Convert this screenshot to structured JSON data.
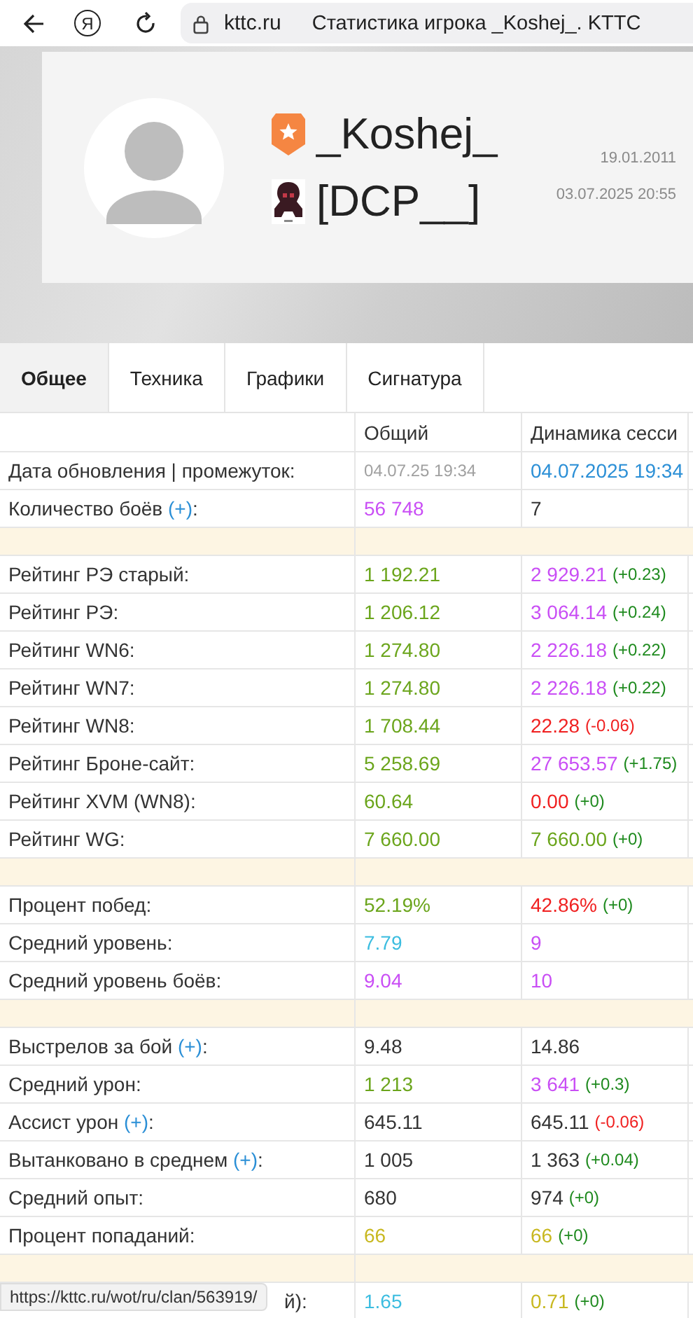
{
  "browser": {
    "logo_glyph": "Я",
    "url": "kttc.ru",
    "title": "Статистика игрока _Koshej_. KTTC"
  },
  "profile": {
    "name": "_Koshej_",
    "clan": "[DCP__]",
    "registered": "19.01.2011",
    "last_battle": "03.07.2025 20:55"
  },
  "tabs": [
    {
      "label": "Общее",
      "selected": true
    },
    {
      "label": "Техника",
      "selected": false
    },
    {
      "label": "Графики",
      "selected": false
    },
    {
      "label": "Сигнатура",
      "selected": false
    }
  ],
  "table": {
    "columns": [
      "Общий",
      "Динамика сесси"
    ],
    "rows": [
      {
        "kind": "row",
        "label": "Дата обновления | промежуток:",
        "total": {
          "text": "04.07.25 19:34",
          "color": "#a0a0a0",
          "small": true
        },
        "session": {
          "text": "04.07.2025 19:34",
          "color": "#2b8fd6"
        }
      },
      {
        "kind": "row",
        "label_parts": [
          {
            "text": "Количество боёв "
          },
          {
            "text": "(+)",
            "kind": "link"
          },
          {
            "text": ":"
          }
        ],
        "total": {
          "text": "56 748",
          "color": "#c94ef5"
        },
        "session": {
          "text": "7",
          "color": "#333333"
        }
      },
      {
        "kind": "separator"
      },
      {
        "kind": "row",
        "label": "Рейтинг РЭ старый:",
        "total": {
          "text": "1 192.21",
          "color": "#6ba51c"
        },
        "session": {
          "text": "2 929.21",
          "color": "#c94ef5"
        },
        "delta": {
          "text": "(+0.23)",
          "color": "#1e8a1e"
        }
      },
      {
        "kind": "row",
        "label": "Рейтинг РЭ:",
        "total": {
          "text": "1 206.12",
          "color": "#6ba51c"
        },
        "session": {
          "text": "3 064.14",
          "color": "#c94ef5"
        },
        "delta": {
          "text": "(+0.24)",
          "color": "#1e8a1e"
        }
      },
      {
        "kind": "row",
        "label": "Рейтинг WN6:",
        "total": {
          "text": "1 274.80",
          "color": "#6ba51c"
        },
        "session": {
          "text": "2 226.18",
          "color": "#c94ef5"
        },
        "delta": {
          "text": "(+0.22)",
          "color": "#1e8a1e"
        }
      },
      {
        "kind": "row",
        "label": "Рейтинг WN7:",
        "total": {
          "text": "1 274.80",
          "color": "#6ba51c"
        },
        "session": {
          "text": "2 226.18",
          "color": "#c94ef5"
        },
        "delta": {
          "text": "(+0.22)",
          "color": "#1e8a1e"
        }
      },
      {
        "kind": "row",
        "label": "Рейтинг WN8:",
        "total": {
          "text": "1 708.44",
          "color": "#6ba51c"
        },
        "session": {
          "text": "22.28",
          "color": "#f02020"
        },
        "delta": {
          "text": "(-0.06)",
          "color": "#f02020"
        }
      },
      {
        "kind": "row",
        "label": "Рейтинг Броне-сайт:",
        "total": {
          "text": "5 258.69",
          "color": "#6ba51c"
        },
        "session": {
          "text": "27 653.57",
          "color": "#c94ef5"
        },
        "delta": {
          "text": "(+1.75)",
          "color": "#1e8a1e"
        }
      },
      {
        "kind": "row",
        "label": "Рейтинг XVM (WN8):",
        "total": {
          "text": "60.64",
          "color": "#6ba51c"
        },
        "session": {
          "text": "0.00",
          "color": "#f02020"
        },
        "delta": {
          "text": "(+0)",
          "color": "#1e8a1e"
        }
      },
      {
        "kind": "row",
        "label": "Рейтинг WG:",
        "total": {
          "text": "7 660.00",
          "color": "#6ba51c"
        },
        "session": {
          "text": "7 660.00",
          "color": "#6ba51c"
        },
        "delta": {
          "text": "(+0)",
          "color": "#1e8a1e"
        }
      },
      {
        "kind": "separator"
      },
      {
        "kind": "row",
        "label": "Процент побед:",
        "total": {
          "text": "52.19%",
          "color": "#6ba51c"
        },
        "session": {
          "text": "42.86%",
          "color": "#f02020"
        },
        "delta": {
          "text": "(+0)",
          "color": "#1e8a1e"
        }
      },
      {
        "kind": "row",
        "label": "Средний уровень:",
        "total": {
          "text": "7.79",
          "color": "#3cbde0"
        },
        "session": {
          "text": "9",
          "color": "#c94ef5"
        }
      },
      {
        "kind": "row",
        "label": "Средний уровень боёв:",
        "total": {
          "text": "9.04",
          "color": "#c94ef5"
        },
        "session": {
          "text": "10",
          "color": "#c94ef5"
        }
      },
      {
        "kind": "separator"
      },
      {
        "kind": "row",
        "label_parts": [
          {
            "text": "Выстрелов за бой "
          },
          {
            "text": "(+)",
            "kind": "link"
          },
          {
            "text": ":"
          }
        ],
        "total": {
          "text": "9.48",
          "color": "#333333"
        },
        "session": {
          "text": "14.86",
          "color": "#333333"
        }
      },
      {
        "kind": "row",
        "label": "Средний урон:",
        "total": {
          "text": "1 213",
          "color": "#6ba51c"
        },
        "session": {
          "text": "3 641",
          "color": "#c94ef5"
        },
        "delta": {
          "text": "(+0.3)",
          "color": "#1e8a1e"
        }
      },
      {
        "kind": "row",
        "label_parts": [
          {
            "text": "Ассист урон "
          },
          {
            "text": "(+)",
            "kind": "link"
          },
          {
            "text": ":"
          }
        ],
        "total": {
          "text": "645.11",
          "color": "#333333"
        },
        "session": {
          "text": "645.11",
          "color": "#333333"
        },
        "delta": {
          "text": "(-0.06)",
          "color": "#f02020"
        }
      },
      {
        "kind": "row",
        "label_parts": [
          {
            "text": "Вытанковано в среднем "
          },
          {
            "text": "(+)",
            "kind": "link"
          },
          {
            "text": ":"
          }
        ],
        "total": {
          "text": "1 005",
          "color": "#333333"
        },
        "session": {
          "text": "1 363",
          "color": "#333333"
        },
        "delta": {
          "text": "(+0.04)",
          "color": "#1e8a1e"
        }
      },
      {
        "kind": "row",
        "label": "Средний опыт:",
        "total": {
          "text": "680",
          "color": "#333333"
        },
        "session": {
          "text": "974",
          "color": "#333333"
        },
        "delta": {
          "text": "(+0)",
          "color": "#1e8a1e"
        }
      },
      {
        "kind": "row",
        "label": "Процент попаданий:",
        "total": {
          "text": "66",
          "color": "#c8b820"
        },
        "session": {
          "text": "66",
          "color": "#c8b820"
        },
        "delta": {
          "text": "(+0)",
          "color": "#1e8a1e"
        }
      },
      {
        "kind": "separator"
      },
      {
        "kind": "covered",
        "label": "й):",
        "total": {
          "text": "1.65",
          "color": "#3cbde0"
        },
        "session": {
          "text": "0.71",
          "color": "#c8b820"
        },
        "delta": {
          "text": "(+0)",
          "color": "#1e8a1e"
        }
      }
    ]
  },
  "status_bar": {
    "url": "https://kttc.ru/wot/ru/clan/563919/"
  }
}
